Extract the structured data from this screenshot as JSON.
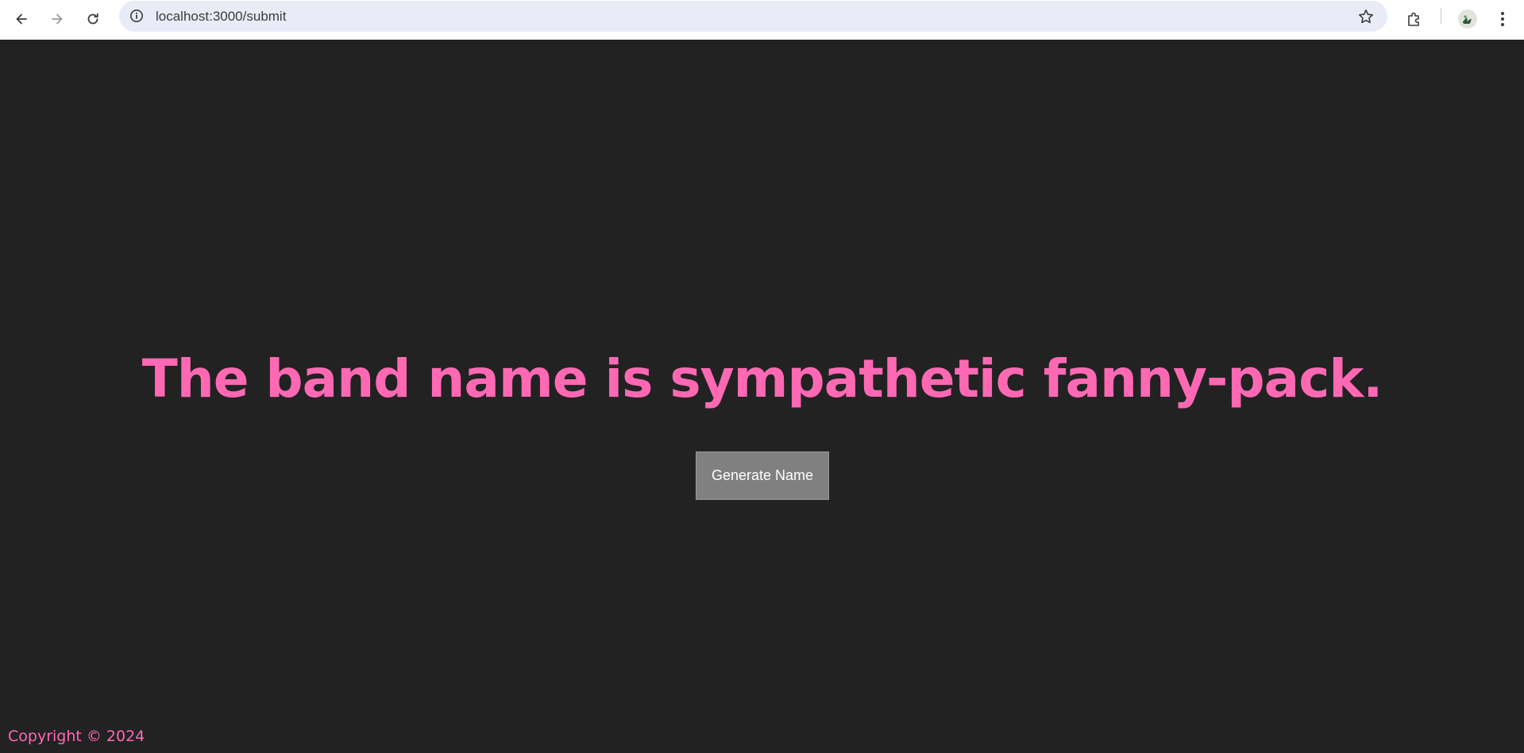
{
  "browser": {
    "url": "localhost:3000/submit",
    "icons": {
      "back": "back-arrow-icon",
      "forward": "forward-arrow-icon",
      "reload": "reload-icon",
      "site_info": "info-icon",
      "bookmark": "star-icon",
      "extensions": "puzzle-icon",
      "profile": "avatar",
      "menu": "kebab-menu-icon"
    }
  },
  "main": {
    "headline": "The band name is sympathetic fanny-pack.",
    "generate_button_label": "Generate Name"
  },
  "footer": {
    "copyright": "Copyright © 2024"
  },
  "colors": {
    "accent_pink": "#ff69b4",
    "background": "#222222",
    "button_bg": "#808080"
  }
}
